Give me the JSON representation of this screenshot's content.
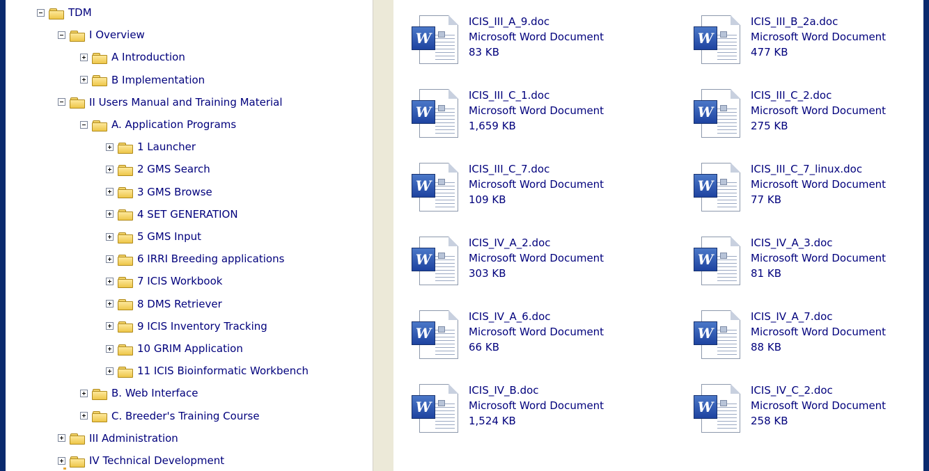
{
  "tree": [
    {
      "label": "TDM",
      "level": 0,
      "expander": "minus",
      "name": "tree-node-tdm"
    },
    {
      "label": "I Overview",
      "level": 1,
      "expander": "minus",
      "name": "tree-node-i-overview"
    },
    {
      "label": "A Introduction",
      "level": 2,
      "expander": "plus",
      "name": "tree-node-a-introduction"
    },
    {
      "label": "B Implementation",
      "level": 2,
      "expander": "plus",
      "name": "tree-node-b-implementation"
    },
    {
      "label": "II Users Manual and Training Material",
      "level": 1,
      "expander": "minus",
      "name": "tree-node-ii-users-manual"
    },
    {
      "label": "A. Application Programs",
      "level": 2,
      "expander": "minus",
      "name": "tree-node-a-application-programs"
    },
    {
      "label": "1 Launcher",
      "level": 3,
      "expander": "plus",
      "name": "tree-node-1-launcher"
    },
    {
      "label": "2 GMS Search",
      "level": 3,
      "expander": "plus",
      "name": "tree-node-2-gms-search"
    },
    {
      "label": "3 GMS Browse",
      "level": 3,
      "expander": "plus",
      "name": "tree-node-3-gms-browse"
    },
    {
      "label": "4 SET GENERATION",
      "level": 3,
      "expander": "plus",
      "name": "tree-node-4-set-generation"
    },
    {
      "label": "5 GMS Input",
      "level": 3,
      "expander": "plus",
      "name": "tree-node-5-gms-input"
    },
    {
      "label": "6 IRRI Breeding applications",
      "level": 3,
      "expander": "plus",
      "name": "tree-node-6-irri-breeding"
    },
    {
      "label": "7 ICIS Workbook",
      "level": 3,
      "expander": "plus",
      "name": "tree-node-7-icis-workbook"
    },
    {
      "label": "8 DMS Retriever",
      "level": 3,
      "expander": "plus",
      "name": "tree-node-8-dms-retriever"
    },
    {
      "label": "9 ICIS Inventory Tracking",
      "level": 3,
      "expander": "plus",
      "name": "tree-node-9-icis-inventory"
    },
    {
      "label": "10 GRIM Application",
      "level": 3,
      "expander": "plus",
      "name": "tree-node-10-grim-application"
    },
    {
      "label": "11 ICIS Bioinformatic Workbench",
      "level": 3,
      "expander": "plus",
      "name": "tree-node-11-icis-bioinformatic"
    },
    {
      "label": "B. Web Interface",
      "level": 2,
      "expander": "plus",
      "name": "tree-node-b-web-interface"
    },
    {
      "label": "C. Breeder's Training Course",
      "level": 2,
      "expander": "plus",
      "name": "tree-node-c-breeders-training"
    },
    {
      "label": "III Administration",
      "level": 1,
      "expander": "plus",
      "name": "tree-node-iii-administration"
    },
    {
      "label": "IV Technical Development",
      "level": 1,
      "expander": "plus",
      "name": "tree-node-iv-technical-development"
    }
  ],
  "files": [
    {
      "name": "ICIS_III_A_9.doc",
      "type": "Microsoft Word Document",
      "size": "83 KB"
    },
    {
      "name": "ICIS_III_B_2a.doc",
      "type": "Microsoft Word Document",
      "size": "477 KB"
    },
    {
      "name": "ICIS_III_C_1.doc",
      "type": "Microsoft Word Document",
      "size": "1,659 KB"
    },
    {
      "name": "ICIS_III_C_2.doc",
      "type": "Microsoft Word Document",
      "size": "275 KB"
    },
    {
      "name": "ICIS_III_C_7.doc",
      "type": "Microsoft Word Document",
      "size": "109 KB"
    },
    {
      "name": "ICIS_III_C_7_linux.doc",
      "type": "Microsoft Word Document",
      "size": "77 KB"
    },
    {
      "name": "ICIS_IV_A_2.doc",
      "type": "Microsoft Word Document",
      "size": "303 KB"
    },
    {
      "name": "ICIS_IV_A_3.doc",
      "type": "Microsoft Word Document",
      "size": "81 KB"
    },
    {
      "name": "ICIS_IV_A_6.doc",
      "type": "Microsoft Word Document",
      "size": "66 KB"
    },
    {
      "name": "ICIS_IV_A_7.doc",
      "type": "Microsoft Word Document",
      "size": "88 KB"
    },
    {
      "name": "ICIS_IV_B.doc",
      "type": "Microsoft Word Document",
      "size": "1,524 KB"
    },
    {
      "name": "ICIS_IV_C_2.doc",
      "type": "Microsoft Word Document",
      "size": "258 KB"
    }
  ],
  "icons": {
    "expander_plus": "plus-box-icon",
    "expander_minus": "minus-box-icon",
    "folder": "folder-icon",
    "file": "word-document-icon",
    "word_glyph": "W"
  },
  "colors": {
    "frame": "#0a2a6e",
    "link_text": "#00007c",
    "folder": "#f3d46b"
  }
}
